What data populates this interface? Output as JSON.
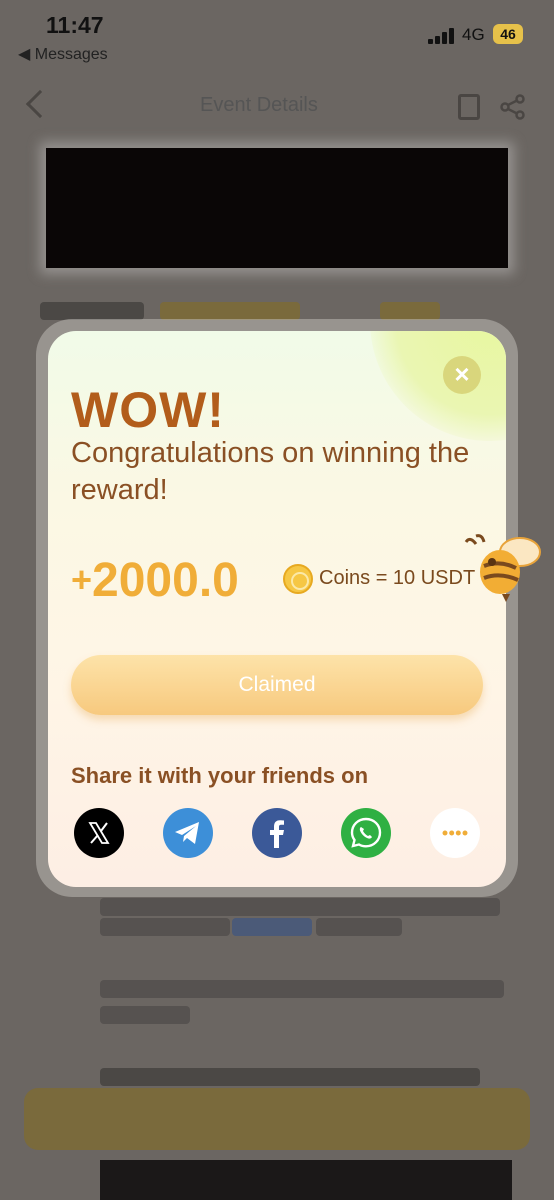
{
  "status_bar": {
    "time": "11:47",
    "back_label": "◀ Messages",
    "network": "4G",
    "battery": "46"
  },
  "background_page": {
    "nav_title": "Event Details"
  },
  "modal": {
    "headline": "WOW!",
    "message": "Congratulations on winning the reward!",
    "amount": "2000.0",
    "amount_prefix": "+",
    "conversion_text": "Coins = 10 USDT",
    "claimed_label": "Claimed",
    "share_label": "Share it with your friends on",
    "share_targets": [
      {
        "name": "x",
        "icon": "x-logo-icon",
        "color": "#000000"
      },
      {
        "name": "telegram",
        "icon": "telegram-icon",
        "color": "#3d8fd8"
      },
      {
        "name": "facebook",
        "icon": "facebook-icon",
        "color": "#3b5998"
      },
      {
        "name": "whatsapp",
        "icon": "whatsapp-icon",
        "color": "#2fb043"
      },
      {
        "name": "more",
        "icon": "more-dots-icon",
        "color": "#ffffff"
      }
    ]
  },
  "colors": {
    "accent": "#f0ad38",
    "headline": "#b25d1b",
    "text": "#8a5024"
  }
}
